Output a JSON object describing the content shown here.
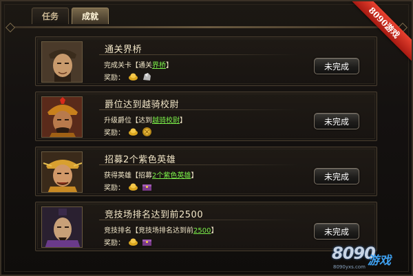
{
  "tabs": [
    {
      "label": "任务",
      "active": false
    },
    {
      "label": "成就",
      "active": true
    }
  ],
  "ribbon": "8090游戏",
  "reward_label": "奖励：",
  "items": [
    {
      "title": "通关界桥",
      "cond_prefix": "完成关卡【通关",
      "cond_highlight": "界桥",
      "cond_suffix": "】",
      "rewards": [
        "gold-ingot-icon",
        "silver-ore-icon"
      ],
      "button": "未完成"
    },
    {
      "title": "爵位达到越骑校尉",
      "cond_prefix": "升级爵位【达到",
      "cond_highlight": "越骑校尉",
      "cond_suffix": "】",
      "rewards": [
        "gold-ingot-icon",
        "gold-medal-icon"
      ],
      "button": "未完成"
    },
    {
      "title": "招募2个紫色英雄",
      "cond_prefix": "获得英雄【招募",
      "cond_highlight": "2个紫色英雄",
      "cond_suffix": "】",
      "rewards": [
        "gold-ingot-icon",
        "purple-chest-icon"
      ],
      "button": "未完成"
    },
    {
      "title": "竞技场排名达到前2500",
      "cond_prefix": "竞技排名【竞技场排名达到前",
      "cond_highlight": "2500",
      "cond_suffix": "】",
      "rewards": [
        "gold-ingot-icon",
        "purple-chest-icon"
      ],
      "button": "未完成"
    }
  ],
  "watermark": {
    "main": "8090",
    "brand": "游戏",
    "url": "8090yxs.com"
  },
  "colors": {
    "accent_green": "#7cf04a",
    "ribbon_red": "#d8301f",
    "frame_gold": "#6a5a40"
  }
}
